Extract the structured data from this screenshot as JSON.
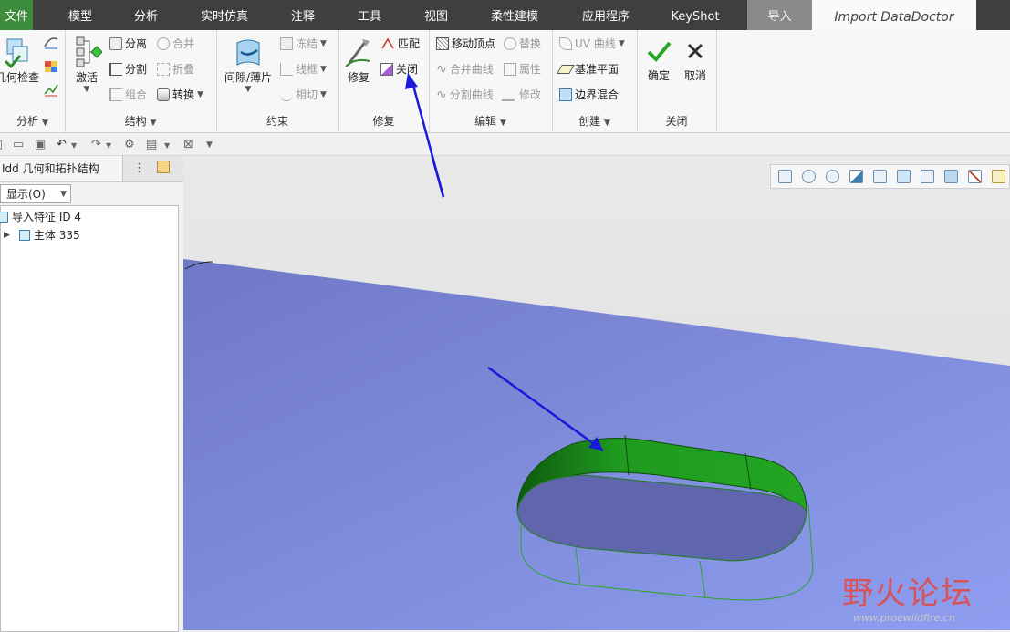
{
  "menu": {
    "file": "文件",
    "model": "模型",
    "analysis": "分析",
    "realtime_sim": "实时仿真",
    "annotate": "注释",
    "tools": "工具",
    "view": "视图",
    "flexible_modeling": "柔性建模",
    "applications": "应用程序",
    "keyshot": "KeyShot",
    "import": "导入",
    "import_doctor": "Import DataDoctor"
  },
  "ribbon": {
    "analysis_group": {
      "geometry_check": "几何检查",
      "label": "分析"
    },
    "structure_group": {
      "activate": "激活",
      "separate": "分离",
      "split": "分割",
      "combine": "组合",
      "merge": "合并",
      "fold": "折叠",
      "convert": "转换",
      "label": "结构"
    },
    "constraint_group": {
      "gap_sheet": "间隙/薄片",
      "freeze": "冻结",
      "wireframe": "线框",
      "tangent": "相切",
      "label": "约束"
    },
    "repair_group": {
      "repair": "修复",
      "match": "匹配",
      "close": "关闭",
      "label": "修复"
    },
    "edit_group": {
      "move_vertex": "移动顶点",
      "replace": "替换",
      "merge_curves": "合并曲线",
      "properties": "属性",
      "split_curves": "分割曲线",
      "modify": "修改",
      "label": "编辑"
    },
    "create_group": {
      "uv_curve": "UV 曲线",
      "datum_plane": "基准平面",
      "boundary_blend": "边界混合",
      "label": "创建"
    },
    "close_group": {
      "ok": "确定",
      "cancel": "取消",
      "label": "关闭"
    }
  },
  "panel": {
    "tab_title": "Idd 几何和拓扑结构",
    "show_label": "显示(O)",
    "tree": [
      {
        "label": "导入特征 ID 4"
      },
      {
        "label": "主体 335"
      }
    ]
  },
  "watermark": {
    "text_main": "野火论坛",
    "text_url": "www.proewildfire.cn"
  },
  "colors": {
    "accent_green": "#3c8c3c",
    "viewport_blue": "#7f8cd8",
    "surface_green": "#1f9a1f",
    "arrow_blue": "#1a1adc"
  }
}
